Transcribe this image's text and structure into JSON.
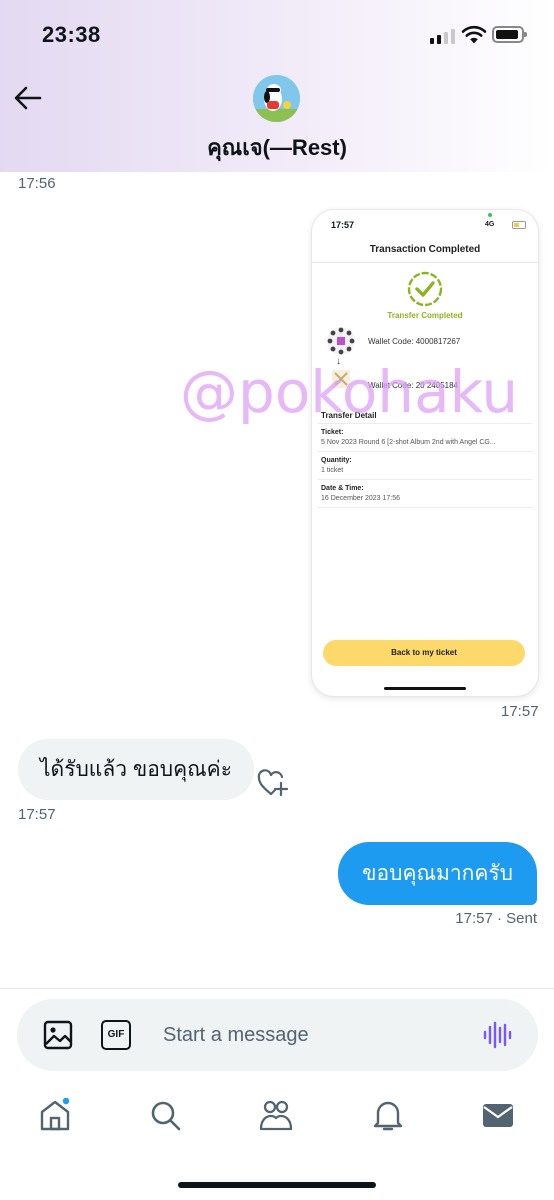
{
  "status_bar": {
    "time": "23:38"
  },
  "header": {
    "contact_name": "คุณเจ(—Rest)"
  },
  "messages": {
    "first_timestamp": "17:56",
    "image_timestamp": "17:57",
    "incoming_text": "ได้รับแล้ว ขอบคุณค่ะ",
    "incoming_timestamp": "17:57",
    "outgoing_text": "ขอบคุณมากครับ",
    "outgoing_status": "17:57 · Sent"
  },
  "attachment": {
    "status_time": "17:57",
    "network": "4G",
    "title": "Transaction Completed",
    "status_text": "Transfer Completed",
    "from_wallet": "Wallet Code: 4000817267",
    "to_wallet": "Wallet Code: 20  2405184",
    "section_title": "Transfer Detail",
    "ticket_label": "Ticket:",
    "ticket_value": "5 Nov 2023 Round 6 [2-shot Album 2nd with Angel CG...",
    "quantity_label": "Quantity:",
    "quantity_value": "1 ticket",
    "datetime_label": "Date & Time:",
    "datetime_value": "16 December 2023 17:56",
    "button_label": "Back to my ticket",
    "check_color": "#8bb51f",
    "button_color": "#fcd96a"
  },
  "watermark": "@pokohaku",
  "composer": {
    "placeholder": "Start a message",
    "gif_label": "GIF",
    "accent_color": "#1d9bf0",
    "voice_color": "#7856ff"
  },
  "icons": {
    "back": "arrow-left-icon",
    "reaction": "heart-plus-icon",
    "image": "image-icon",
    "voice": "voice-wave-icon",
    "tabs": [
      "home-icon",
      "search-icon",
      "communities-icon",
      "bell-icon",
      "mail-icon"
    ]
  }
}
